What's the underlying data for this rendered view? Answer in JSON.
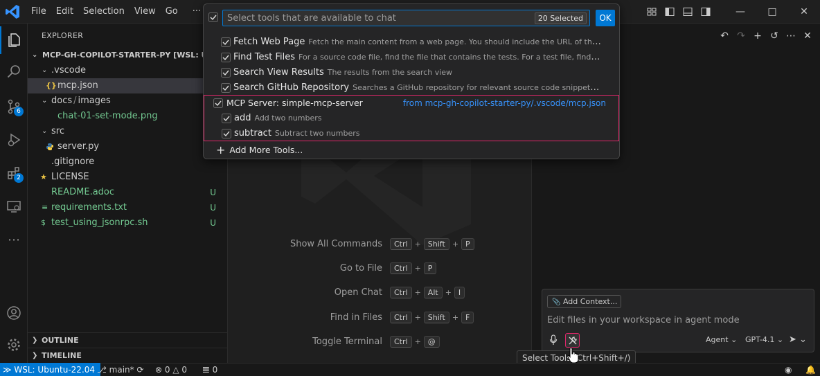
{
  "titlebar": {
    "menus": [
      "File",
      "Edit",
      "Selection",
      "View",
      "Go",
      "···"
    ]
  },
  "activity": {
    "scm_badge": "6",
    "extensions_badge": "2"
  },
  "explorer": {
    "title": "EXPLORER",
    "root": "MCP-GH-COPILOT-STARTER-PY [WSL: UBUNTU",
    "items": [
      {
        "name": ".vscode",
        "status": ""
      },
      {
        "name": "mcp.json",
        "status": ""
      },
      {
        "name": "docs",
        "sep": "/",
        "name2": "images",
        "status": ""
      },
      {
        "name": "chat-01-set-mode.png",
        "status": ""
      },
      {
        "name": "src",
        "status": ""
      },
      {
        "name": "server.py",
        "status": ""
      },
      {
        "name": ".gitignore",
        "status": ""
      },
      {
        "name": "LICENSE",
        "status": ""
      },
      {
        "name": "README.adoc",
        "status": "U"
      },
      {
        "name": "requirements.txt",
        "status": "U"
      },
      {
        "name": "test_using_jsonrpc.sh",
        "status": "U"
      }
    ],
    "outline": "OUTLINE",
    "timeline": "TIMELINE"
  },
  "editor": {
    "shortcuts": [
      {
        "label": "Show All Commands",
        "keys": [
          "Ctrl",
          "Shift",
          "P"
        ]
      },
      {
        "label": "Go to File",
        "keys": [
          "Ctrl",
          "P"
        ]
      },
      {
        "label": "Open Chat",
        "keys": [
          "Ctrl",
          "Alt",
          "I"
        ]
      },
      {
        "label": "Find in Files",
        "keys": [
          "Ctrl",
          "Shift",
          "F"
        ]
      },
      {
        "label": "Toggle Terminal",
        "keys": [
          "Ctrl",
          "@"
        ]
      }
    ],
    "plus": "+"
  },
  "quickpick": {
    "placeholder": "Select tools that are available to chat",
    "count": "20 Selected",
    "ok": "OK",
    "tools": [
      {
        "title": "Fetch Web Page",
        "desc": "Fetch the main content from a web page. You should include the URL of the page ..."
      },
      {
        "title": "Find Test Files",
        "desc": "For a source code file, find the file that contains the tests. For a test file, find the file t..."
      },
      {
        "title": "Search View Results",
        "desc": "The results from the search view"
      },
      {
        "title": "Search GitHub Repository",
        "desc": "Searches a GitHub repository for relevant source code snippets. You can..."
      }
    ],
    "server": {
      "title": "MCP Server: simple-mcp-server",
      "link": "from mcp-gh-copilot-starter-py/.vscode/mcp.json",
      "tools": [
        {
          "title": "add",
          "desc": "Add two numbers"
        },
        {
          "title": "subtract",
          "desc": "Subtract two numbers"
        }
      ]
    },
    "add_more": "Add More Tools..."
  },
  "chat": {
    "add_context": "Add Context...",
    "placeholder": "Edit files in your workspace in agent mode",
    "mode": "Agent",
    "model": "GPT-4.1",
    "tooltip": "Select Tools (Ctrl+Shift+/)"
  },
  "statusbar": {
    "remote": "WSL: Ubuntu-22.04",
    "branch": "main*",
    "errors": "0",
    "warnings": "0",
    "ports": "0"
  }
}
